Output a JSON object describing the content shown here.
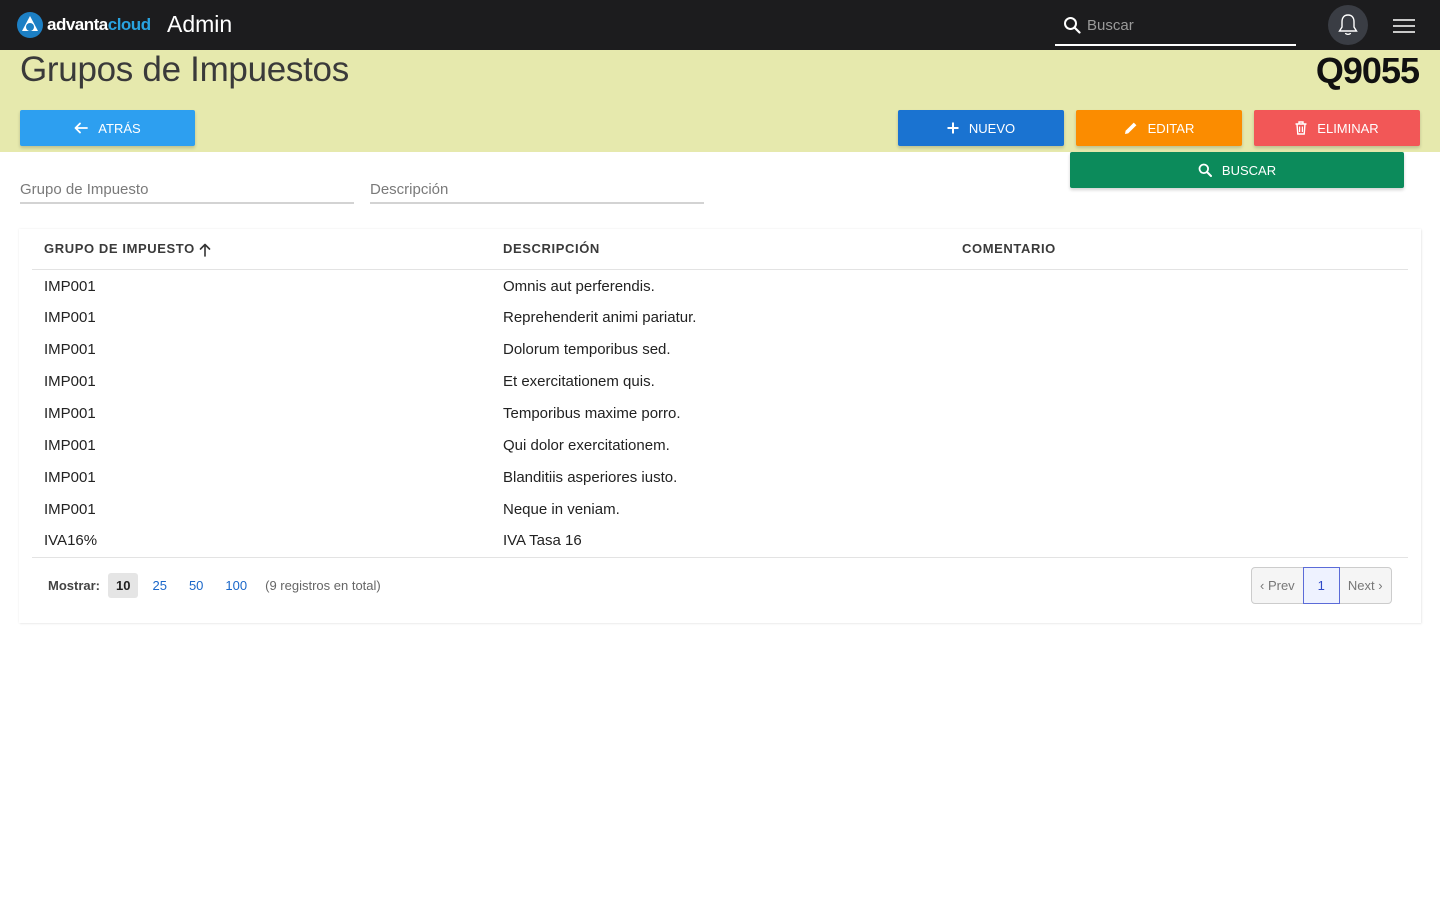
{
  "brand": {
    "logo_white": "advanta",
    "logo_color": "cloud",
    "app_title": "Admin"
  },
  "search": {
    "placeholder": "Buscar"
  },
  "header": {
    "title": "Grupos de Impuestos",
    "code": "Q9055"
  },
  "toolbar": {
    "back_label": "ATRÁS",
    "new_label": "NUEVO",
    "edit_label": "EDITAR",
    "delete_label": "ELIMINAR",
    "search_label": "BUSCAR"
  },
  "filters": {
    "group_placeholder": "Grupo de Impuesto",
    "description_placeholder": "Descripción"
  },
  "table": {
    "columns": [
      "GRUPO DE IMPUESTO",
      "DESCRIPCIÓN",
      "COMENTARIO"
    ],
    "rows": [
      [
        "IMP001",
        "Omnis aut perferendis.",
        ""
      ],
      [
        "IMP001",
        "Reprehenderit animi pariatur.",
        ""
      ],
      [
        "IMP001",
        "Dolorum temporibus sed.",
        ""
      ],
      [
        "IMP001",
        "Et exercitationem quis.",
        ""
      ],
      [
        "IMP001",
        "Temporibus maxime porro.",
        ""
      ],
      [
        "IMP001",
        "Qui dolor exercitationem.",
        ""
      ],
      [
        "IMP001",
        "Blanditiis asperiores iusto.",
        ""
      ],
      [
        "IMP001",
        "Neque in veniam.",
        ""
      ],
      [
        "IVA16%",
        "IVA Tasa 16",
        ""
      ]
    ]
  },
  "pager": {
    "show_label": "Mostrar:",
    "sizes": [
      "10",
      "25",
      "50",
      "100"
    ],
    "total": "(9 registros en total)",
    "prev": "‹ Prev",
    "current": "1",
    "next": "Next ›"
  },
  "colors": {
    "topbar": "#1c1c1e",
    "header_band": "#e6e9ad",
    "back": "#2d9ff0",
    "new": "#1a73d1",
    "edit": "#fb8c00",
    "delete": "#f25757",
    "search": "#0c8b5b"
  }
}
